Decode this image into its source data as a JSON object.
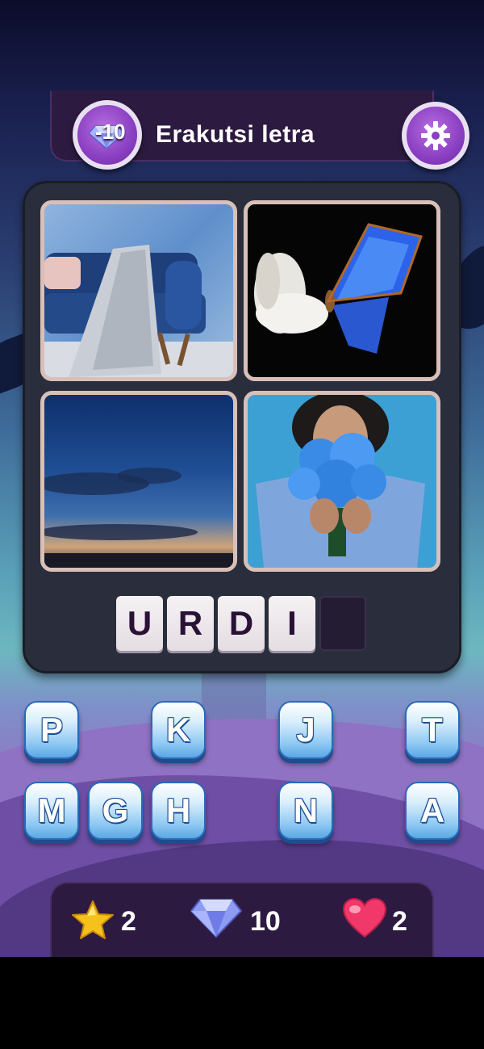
{
  "header": {
    "title": "Erakutsi letra",
    "hint_cost": "-10"
  },
  "icons": {
    "hint": "gem-icon",
    "settings": "gear-icon",
    "stars": "star-icon",
    "gems": "diamond-icon",
    "lives": "heart-icon"
  },
  "pictures": [
    {
      "subject": "blue sofa with knit blanket"
    },
    {
      "subject": "blue butterfly and white tulip"
    },
    {
      "subject": "blue evening sky"
    },
    {
      "subject": "woman with blue flower bouquet"
    }
  ],
  "answer_slots": [
    "U",
    "R",
    "D",
    "I",
    ""
  ],
  "keyboard": {
    "row1": [
      "P",
      "K",
      "J",
      "T"
    ],
    "row2": [
      "M",
      "G",
      "H",
      "N",
      "A"
    ]
  },
  "footer": {
    "stars": "2",
    "gems": "10",
    "lives": "2"
  },
  "colors": {
    "accent_purple": "#8a3fc2",
    "key_blue": "#5aa7e4",
    "panel_dark": "#2a2e3c"
  }
}
